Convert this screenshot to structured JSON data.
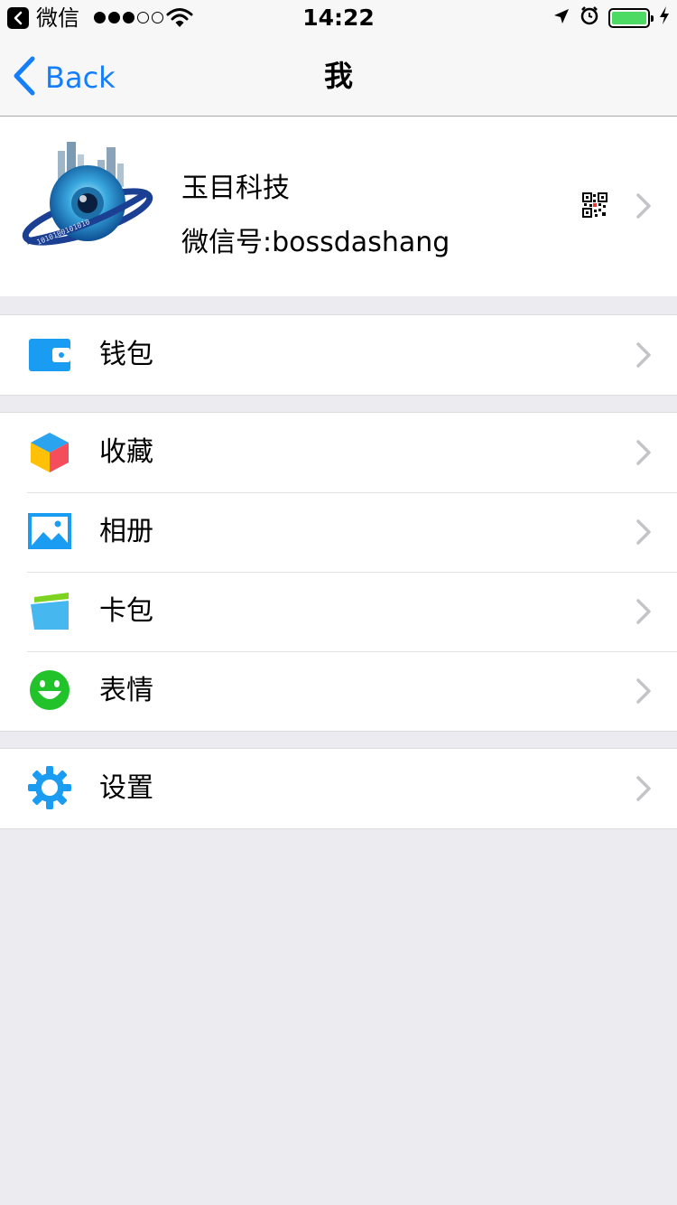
{
  "status_bar": {
    "back_app": "微信",
    "signal": [
      true,
      true,
      true,
      false,
      false
    ],
    "time": "14:22",
    "battery_level": 1.0
  },
  "nav": {
    "back_label": "Back",
    "title": "我"
  },
  "profile": {
    "name": "玉目科技",
    "wechat_id": "微信号:bossdashang",
    "avatar_icon": "eye-globe-logo",
    "qr_icon": "qr-code-icon"
  },
  "groups": [
    {
      "items": [
        {
          "label": "钱包",
          "icon": "wallet-icon"
        }
      ]
    },
    {
      "items": [
        {
          "label": "收藏",
          "icon": "favorites-cube-icon"
        },
        {
          "label": "相册",
          "icon": "album-icon"
        },
        {
          "label": "卡包",
          "icon": "card-package-icon"
        },
        {
          "label": "表情",
          "icon": "smiley-icon"
        }
      ]
    },
    {
      "items": [
        {
          "label": "设置",
          "icon": "gear-icon"
        }
      ]
    }
  ],
  "colors": {
    "accent": "#157efb",
    "wallet": "#1a9cf2",
    "smiley": "#22c22a",
    "settings": "#1a9cf2",
    "battery": "#4cd964"
  }
}
